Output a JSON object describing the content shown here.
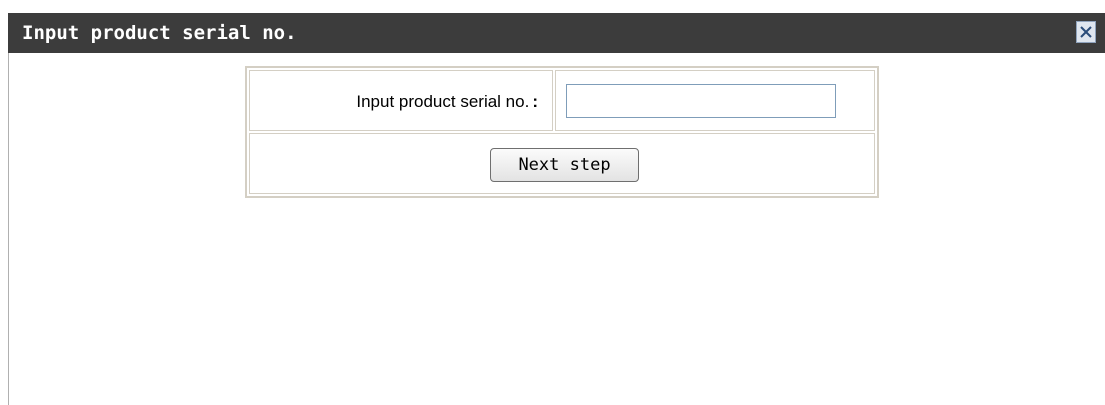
{
  "dialog": {
    "title": "Input product serial no.",
    "close_icon": "close-icon"
  },
  "form": {
    "serial_label": "Input product serial no.",
    "serial_colon": ":",
    "serial_value": "",
    "serial_placeholder": "",
    "next_button_label": "Next step"
  },
  "colors": {
    "titlebar": "#3c3c3c",
    "title_text": "#ffffff",
    "table_border": "#d4cfc4",
    "input_border": "#7f9db9"
  }
}
